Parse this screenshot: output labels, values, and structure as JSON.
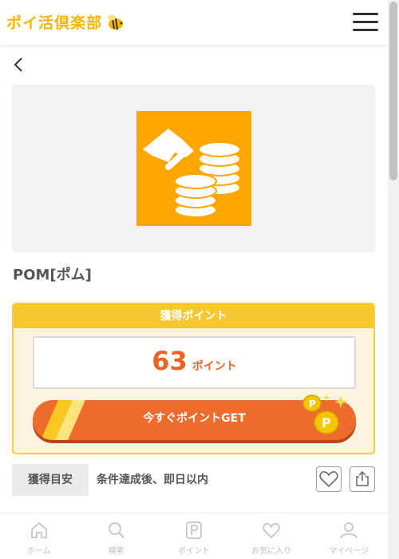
{
  "header": {
    "logo_text": "ポイ活倶楽部",
    "menu_icon": "hamburger-menu-icon"
  },
  "colors": {
    "accent": "#f7b500",
    "orange": "#ee6b2e",
    "point_header": "#f6c72e",
    "hero_tile": "#ffa600"
  },
  "offer": {
    "title": "POM[ポム]",
    "point_header": "獲得ポイント",
    "points": "63",
    "points_unit": "ポイント",
    "get_button_label": "今すぐポイントGET"
  },
  "info": {
    "label": "獲得目安",
    "value": "条件達成後、即日以内"
  },
  "tabs": [
    {
      "label": "ホーム",
      "icon": "home-icon"
    },
    {
      "label": "検索",
      "icon": "search-icon"
    },
    {
      "label": "ポイント",
      "icon": "point-icon"
    },
    {
      "label": "お気に入り",
      "icon": "heart-icon"
    },
    {
      "label": "マイページ",
      "icon": "user-icon"
    }
  ]
}
